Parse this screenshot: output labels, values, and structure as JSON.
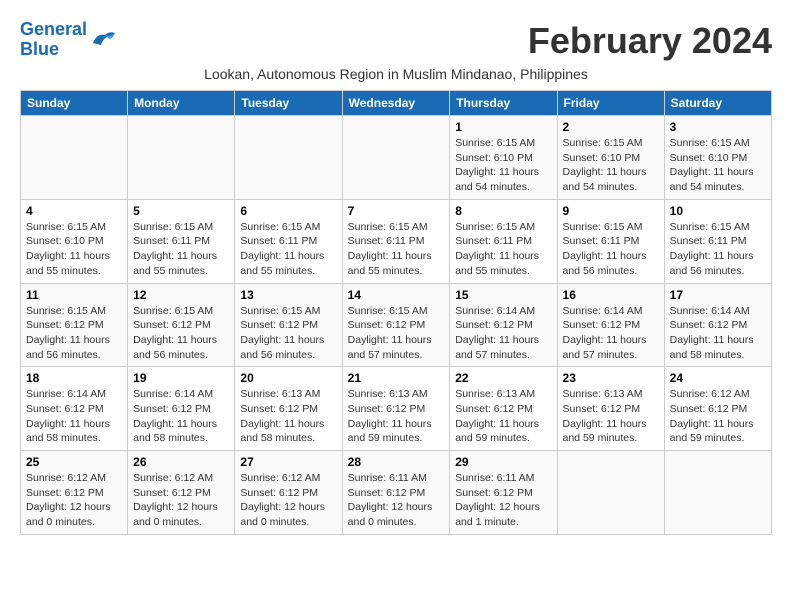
{
  "header": {
    "logo_line1": "General",
    "logo_line2": "Blue",
    "month_title": "February 2024",
    "subtitle": "Lookan, Autonomous Region in Muslim Mindanao, Philippines"
  },
  "weekdays": [
    "Sunday",
    "Monday",
    "Tuesday",
    "Wednesday",
    "Thursday",
    "Friday",
    "Saturday"
  ],
  "weeks": [
    [
      {
        "day": "",
        "info": ""
      },
      {
        "day": "",
        "info": ""
      },
      {
        "day": "",
        "info": ""
      },
      {
        "day": "",
        "info": ""
      },
      {
        "day": "1",
        "info": "Sunrise: 6:15 AM\nSunset: 6:10 PM\nDaylight: 11 hours\nand 54 minutes."
      },
      {
        "day": "2",
        "info": "Sunrise: 6:15 AM\nSunset: 6:10 PM\nDaylight: 11 hours\nand 54 minutes."
      },
      {
        "day": "3",
        "info": "Sunrise: 6:15 AM\nSunset: 6:10 PM\nDaylight: 11 hours\nand 54 minutes."
      }
    ],
    [
      {
        "day": "4",
        "info": "Sunrise: 6:15 AM\nSunset: 6:10 PM\nDaylight: 11 hours\nand 55 minutes."
      },
      {
        "day": "5",
        "info": "Sunrise: 6:15 AM\nSunset: 6:11 PM\nDaylight: 11 hours\nand 55 minutes."
      },
      {
        "day": "6",
        "info": "Sunrise: 6:15 AM\nSunset: 6:11 PM\nDaylight: 11 hours\nand 55 minutes."
      },
      {
        "day": "7",
        "info": "Sunrise: 6:15 AM\nSunset: 6:11 PM\nDaylight: 11 hours\nand 55 minutes."
      },
      {
        "day": "8",
        "info": "Sunrise: 6:15 AM\nSunset: 6:11 PM\nDaylight: 11 hours\nand 55 minutes."
      },
      {
        "day": "9",
        "info": "Sunrise: 6:15 AM\nSunset: 6:11 PM\nDaylight: 11 hours\nand 56 minutes."
      },
      {
        "day": "10",
        "info": "Sunrise: 6:15 AM\nSunset: 6:11 PM\nDaylight: 11 hours\nand 56 minutes."
      }
    ],
    [
      {
        "day": "11",
        "info": "Sunrise: 6:15 AM\nSunset: 6:12 PM\nDaylight: 11 hours\nand 56 minutes."
      },
      {
        "day": "12",
        "info": "Sunrise: 6:15 AM\nSunset: 6:12 PM\nDaylight: 11 hours\nand 56 minutes."
      },
      {
        "day": "13",
        "info": "Sunrise: 6:15 AM\nSunset: 6:12 PM\nDaylight: 11 hours\nand 56 minutes."
      },
      {
        "day": "14",
        "info": "Sunrise: 6:15 AM\nSunset: 6:12 PM\nDaylight: 11 hours\nand 57 minutes."
      },
      {
        "day": "15",
        "info": "Sunrise: 6:14 AM\nSunset: 6:12 PM\nDaylight: 11 hours\nand 57 minutes."
      },
      {
        "day": "16",
        "info": "Sunrise: 6:14 AM\nSunset: 6:12 PM\nDaylight: 11 hours\nand 57 minutes."
      },
      {
        "day": "17",
        "info": "Sunrise: 6:14 AM\nSunset: 6:12 PM\nDaylight: 11 hours\nand 58 minutes."
      }
    ],
    [
      {
        "day": "18",
        "info": "Sunrise: 6:14 AM\nSunset: 6:12 PM\nDaylight: 11 hours\nand 58 minutes."
      },
      {
        "day": "19",
        "info": "Sunrise: 6:14 AM\nSunset: 6:12 PM\nDaylight: 11 hours\nand 58 minutes."
      },
      {
        "day": "20",
        "info": "Sunrise: 6:13 AM\nSunset: 6:12 PM\nDaylight: 11 hours\nand 58 minutes."
      },
      {
        "day": "21",
        "info": "Sunrise: 6:13 AM\nSunset: 6:12 PM\nDaylight: 11 hours\nand 59 minutes."
      },
      {
        "day": "22",
        "info": "Sunrise: 6:13 AM\nSunset: 6:12 PM\nDaylight: 11 hours\nand 59 minutes."
      },
      {
        "day": "23",
        "info": "Sunrise: 6:13 AM\nSunset: 6:12 PM\nDaylight: 11 hours\nand 59 minutes."
      },
      {
        "day": "24",
        "info": "Sunrise: 6:12 AM\nSunset: 6:12 PM\nDaylight: 11 hours\nand 59 minutes."
      }
    ],
    [
      {
        "day": "25",
        "info": "Sunrise: 6:12 AM\nSunset: 6:12 PM\nDaylight: 12 hours\nand 0 minutes."
      },
      {
        "day": "26",
        "info": "Sunrise: 6:12 AM\nSunset: 6:12 PM\nDaylight: 12 hours\nand 0 minutes."
      },
      {
        "day": "27",
        "info": "Sunrise: 6:12 AM\nSunset: 6:12 PM\nDaylight: 12 hours\nand 0 minutes."
      },
      {
        "day": "28",
        "info": "Sunrise: 6:11 AM\nSunset: 6:12 PM\nDaylight: 12 hours\nand 0 minutes."
      },
      {
        "day": "29",
        "info": "Sunrise: 6:11 AM\nSunset: 6:12 PM\nDaylight: 12 hours\nand 1 minute."
      },
      {
        "day": "",
        "info": ""
      },
      {
        "day": "",
        "info": ""
      }
    ]
  ]
}
